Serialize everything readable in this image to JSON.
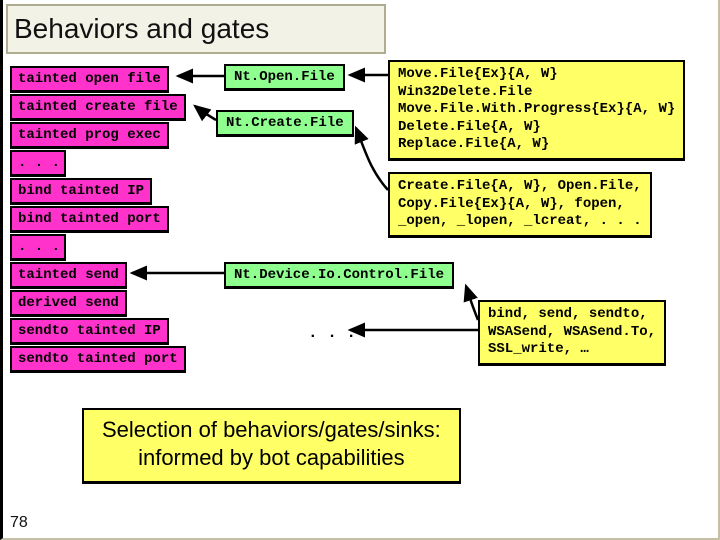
{
  "title": "Behaviors and gates",
  "left_col": {
    "r0": "tainted open file",
    "r1": "tainted create file",
    "r2": "tainted prog exec",
    "d0": ". . .",
    "r3": "bind tainted IP",
    "r4": "bind tainted port",
    "d1": ". . .",
    "r5": "tainted send",
    "r6": "derived send",
    "r7": "sendto tainted IP",
    "r8": "sendto tainted port"
  },
  "green": {
    "g0": "Nt.Open.File",
    "g1": "Nt.Create.File",
    "g2": "Nt.Device.Io.Control.File",
    "gdots": ". . ."
  },
  "yellow": {
    "y0": "Move.File{Ex}{A, W}\nWin32Delete.File\nMove.File.With.Progress{Ex}{A, W}\nDelete.File{A, W}\nReplace.File{A, W}",
    "y1": "Create.File{A, W}, Open.File,\nCopy.File{Ex}{A, W}, fopen,\n_open, _lopen, _lcreat, . . .",
    "y2": "bind, send, sendto,\nWSASend, WSASend.To,\nSSL_write, …"
  },
  "conclusion": "Selection of behaviors/gates/sinks:\ninformed by bot capabilities",
  "page": "78"
}
